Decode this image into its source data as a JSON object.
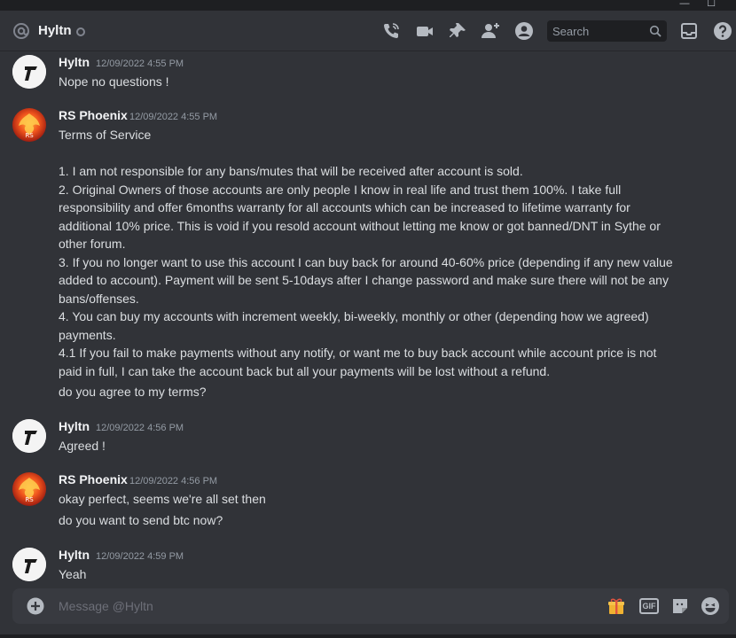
{
  "header": {
    "channel_name": "Hyltn",
    "search_placeholder": "Search"
  },
  "messages": [
    {
      "author": "Hyltn",
      "time": "12/09/2022 4:55 PM",
      "lines": [
        "Nope no questions !"
      ]
    },
    {
      "author": "RS Phoenix",
      "time": "12/09/2022 4:55 PM",
      "lines": [
        "Terms of Service",
        "",
        "1. I am not responsible for any bans/mutes that will be received after account is sold.",
        "2. Original Owners of those accounts are only people I know in real life and trust them 100%. I take full",
        "responsibility and offer 6months warranty for all accounts which can be increased to lifetime warranty for",
        "additional 10% price. This is void if you resold account without letting me know or got banned/DNT in Sythe or",
        "other forum.",
        "3. If you no longer want to use this account I can buy back for around 40-60% price (depending if any new value",
        "added to account). Payment will be sent 5-10days after I change password and make sure there will not be any",
        "bans/offenses.",
        "4. You can buy my accounts with increment weekly, bi-weekly, monthly or other (depending how we agreed)",
        "payments.",
        "4.1 If you fail to make payments without any notify, or want me to buy back account while account price is not",
        "paid in full, I can take the account back but all your payments will be lost without a refund."
      ],
      "followup": "do you agree to my terms?"
    },
    {
      "author": "Hyltn",
      "time": "12/09/2022 4:56 PM",
      "lines": [
        "Agreed !"
      ]
    },
    {
      "author": "RS Phoenix",
      "time": "12/09/2022 4:56 PM",
      "lines": [
        "okay perfect, seems we're all set then"
      ],
      "followup": "do you want to send btc now?"
    },
    {
      "author": "Hyltn",
      "time": "12/09/2022 4:59 PM",
      "lines": [
        "Yeah"
      ]
    }
  ],
  "composer": {
    "placeholder": "Message @Hyltn",
    "gif_label": "GIF"
  },
  "window": {
    "minimize": "—",
    "maximize": "☐"
  },
  "colors": {
    "background": "#313338",
    "composer": "#383a40",
    "text": "#dbdee1",
    "muted": "#949ba4"
  }
}
